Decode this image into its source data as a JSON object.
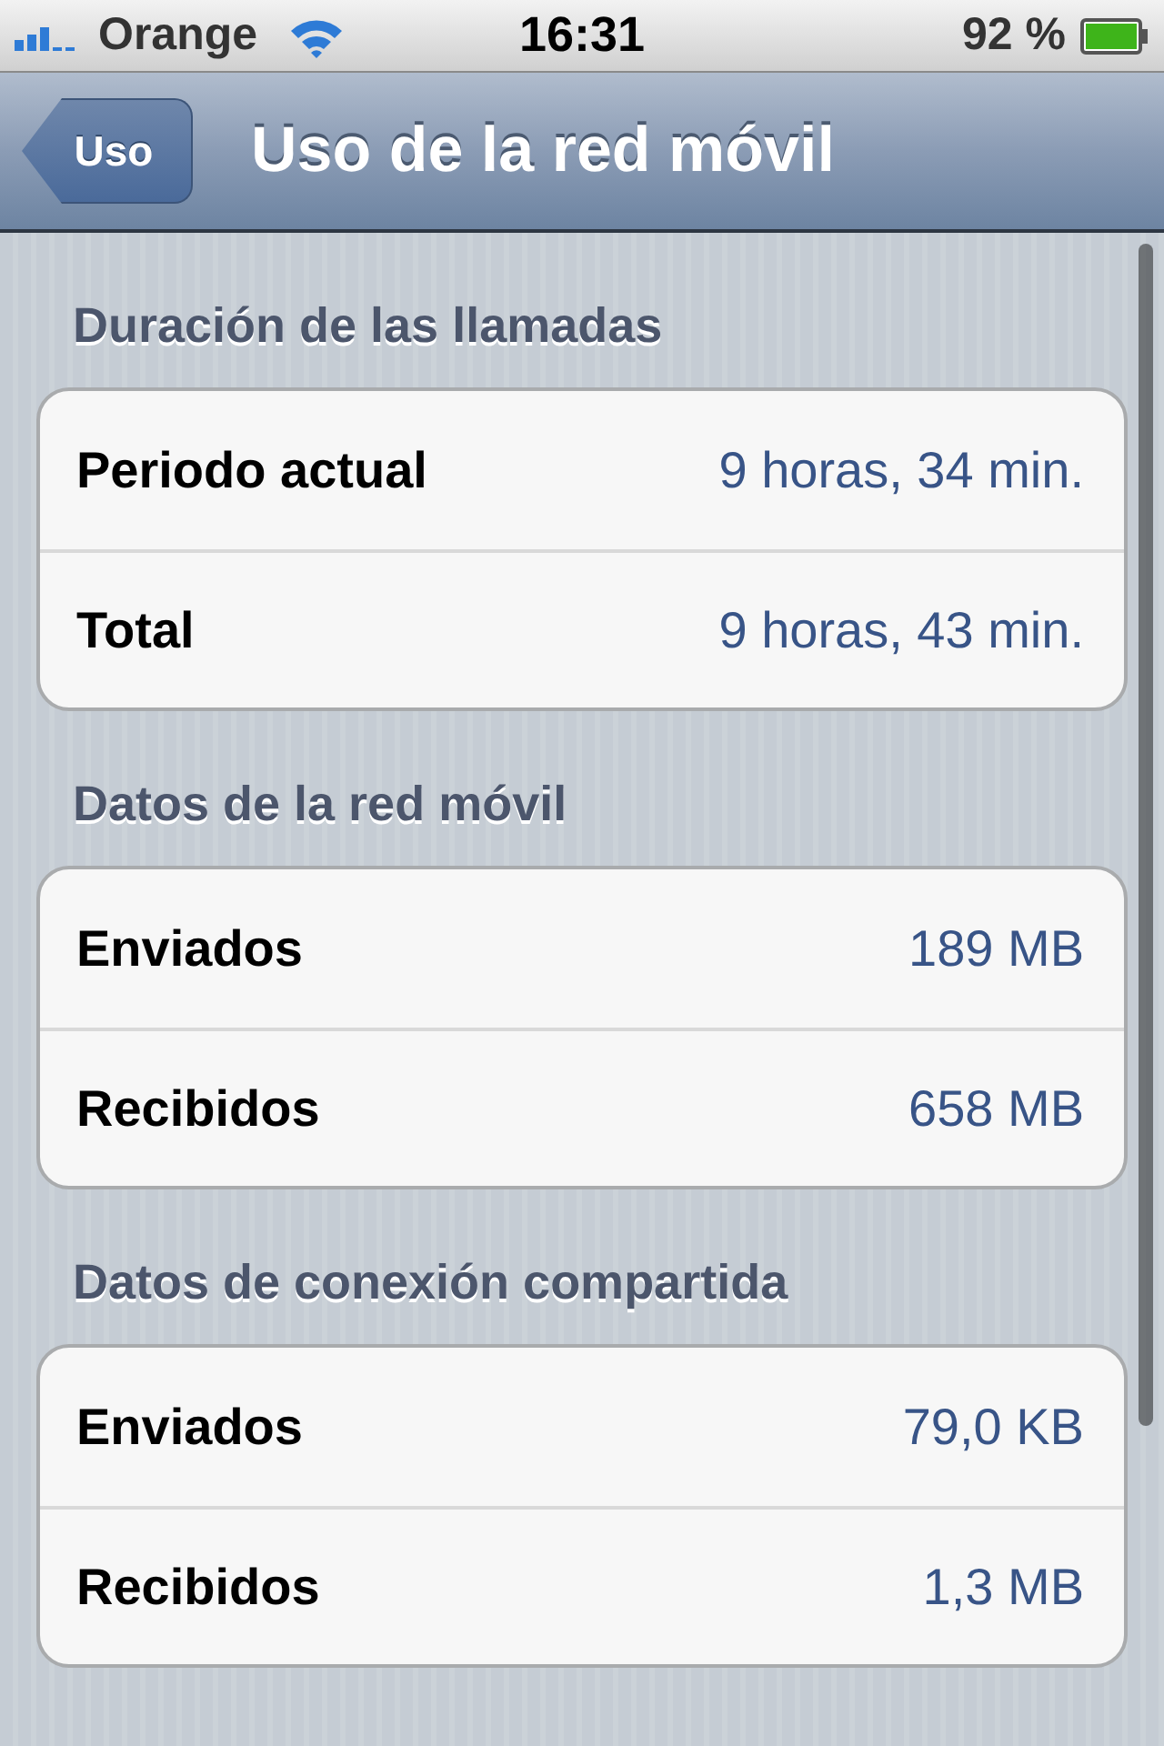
{
  "status_bar": {
    "carrier": "Orange",
    "time": "16:31",
    "battery": "92 %"
  },
  "nav_bar": {
    "back_button": "Uso",
    "title": "Uso de la red móvil"
  },
  "sections": [
    {
      "header": "Duración de las llamadas",
      "rows": [
        {
          "label": "Periodo actual",
          "value": "9 horas, 34 min."
        },
        {
          "label": "Total",
          "value": "9 horas, 43 min."
        }
      ]
    },
    {
      "header": "Datos de la red móvil",
      "rows": [
        {
          "label": "Enviados",
          "value": "189 MB"
        },
        {
          "label": "Recibidos",
          "value": "658 MB"
        }
      ]
    },
    {
      "header": "Datos de conexión compartida",
      "rows": [
        {
          "label": "Enviados",
          "value": "79,0 KB"
        },
        {
          "label": "Recibidos",
          "value": "1,3 MB"
        }
      ]
    }
  ]
}
